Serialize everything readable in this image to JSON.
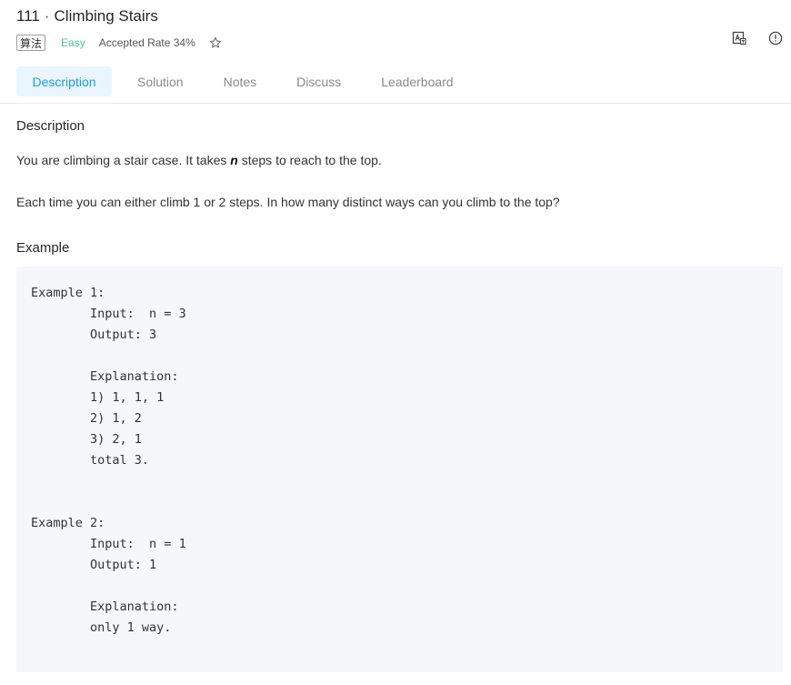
{
  "problem": {
    "number": "111",
    "separator": "·",
    "title": "Climbing Stairs",
    "category_tag": "算法",
    "difficulty": "Easy",
    "accepted_rate": "Accepted Rate 34%"
  },
  "header_icons": {
    "star": "star-outline-icon",
    "image_translate": "image-translate-icon",
    "report": "info-circle-icon"
  },
  "tabs": [
    {
      "label": "Description",
      "active": true
    },
    {
      "label": "Solution",
      "active": false
    },
    {
      "label": "Notes",
      "active": false
    },
    {
      "label": "Discuss",
      "active": false
    },
    {
      "label": "Leaderboard",
      "active": false
    }
  ],
  "description": {
    "heading": "Description",
    "p1_before": "You are climbing a stair case. It takes ",
    "p1_emphasis": "n",
    "p1_after": " steps to reach to the top.",
    "p2": "Each time you can either climb 1 or 2 steps. In how many distinct ways can you climb to the top?"
  },
  "example": {
    "heading": "Example",
    "code": "Example 1:\n\tInput:  n = 3\n\tOutput: 3\n\t\n\tExplanation:\n\t1) 1, 1, 1\n\t2) 1, 2\n\t3) 2, 1\n\ttotal 3.\n\n\nExample 2:\n\tInput:  n = 1\n\tOutput: 1\n\t\n\tExplanation:\n\tonly 1 way."
  },
  "colors": {
    "accent": "#1a9ee6",
    "active_tab_bg": "#e9f6ff",
    "easy_green": "#4cc78f",
    "code_bg": "#f6f7f9"
  }
}
